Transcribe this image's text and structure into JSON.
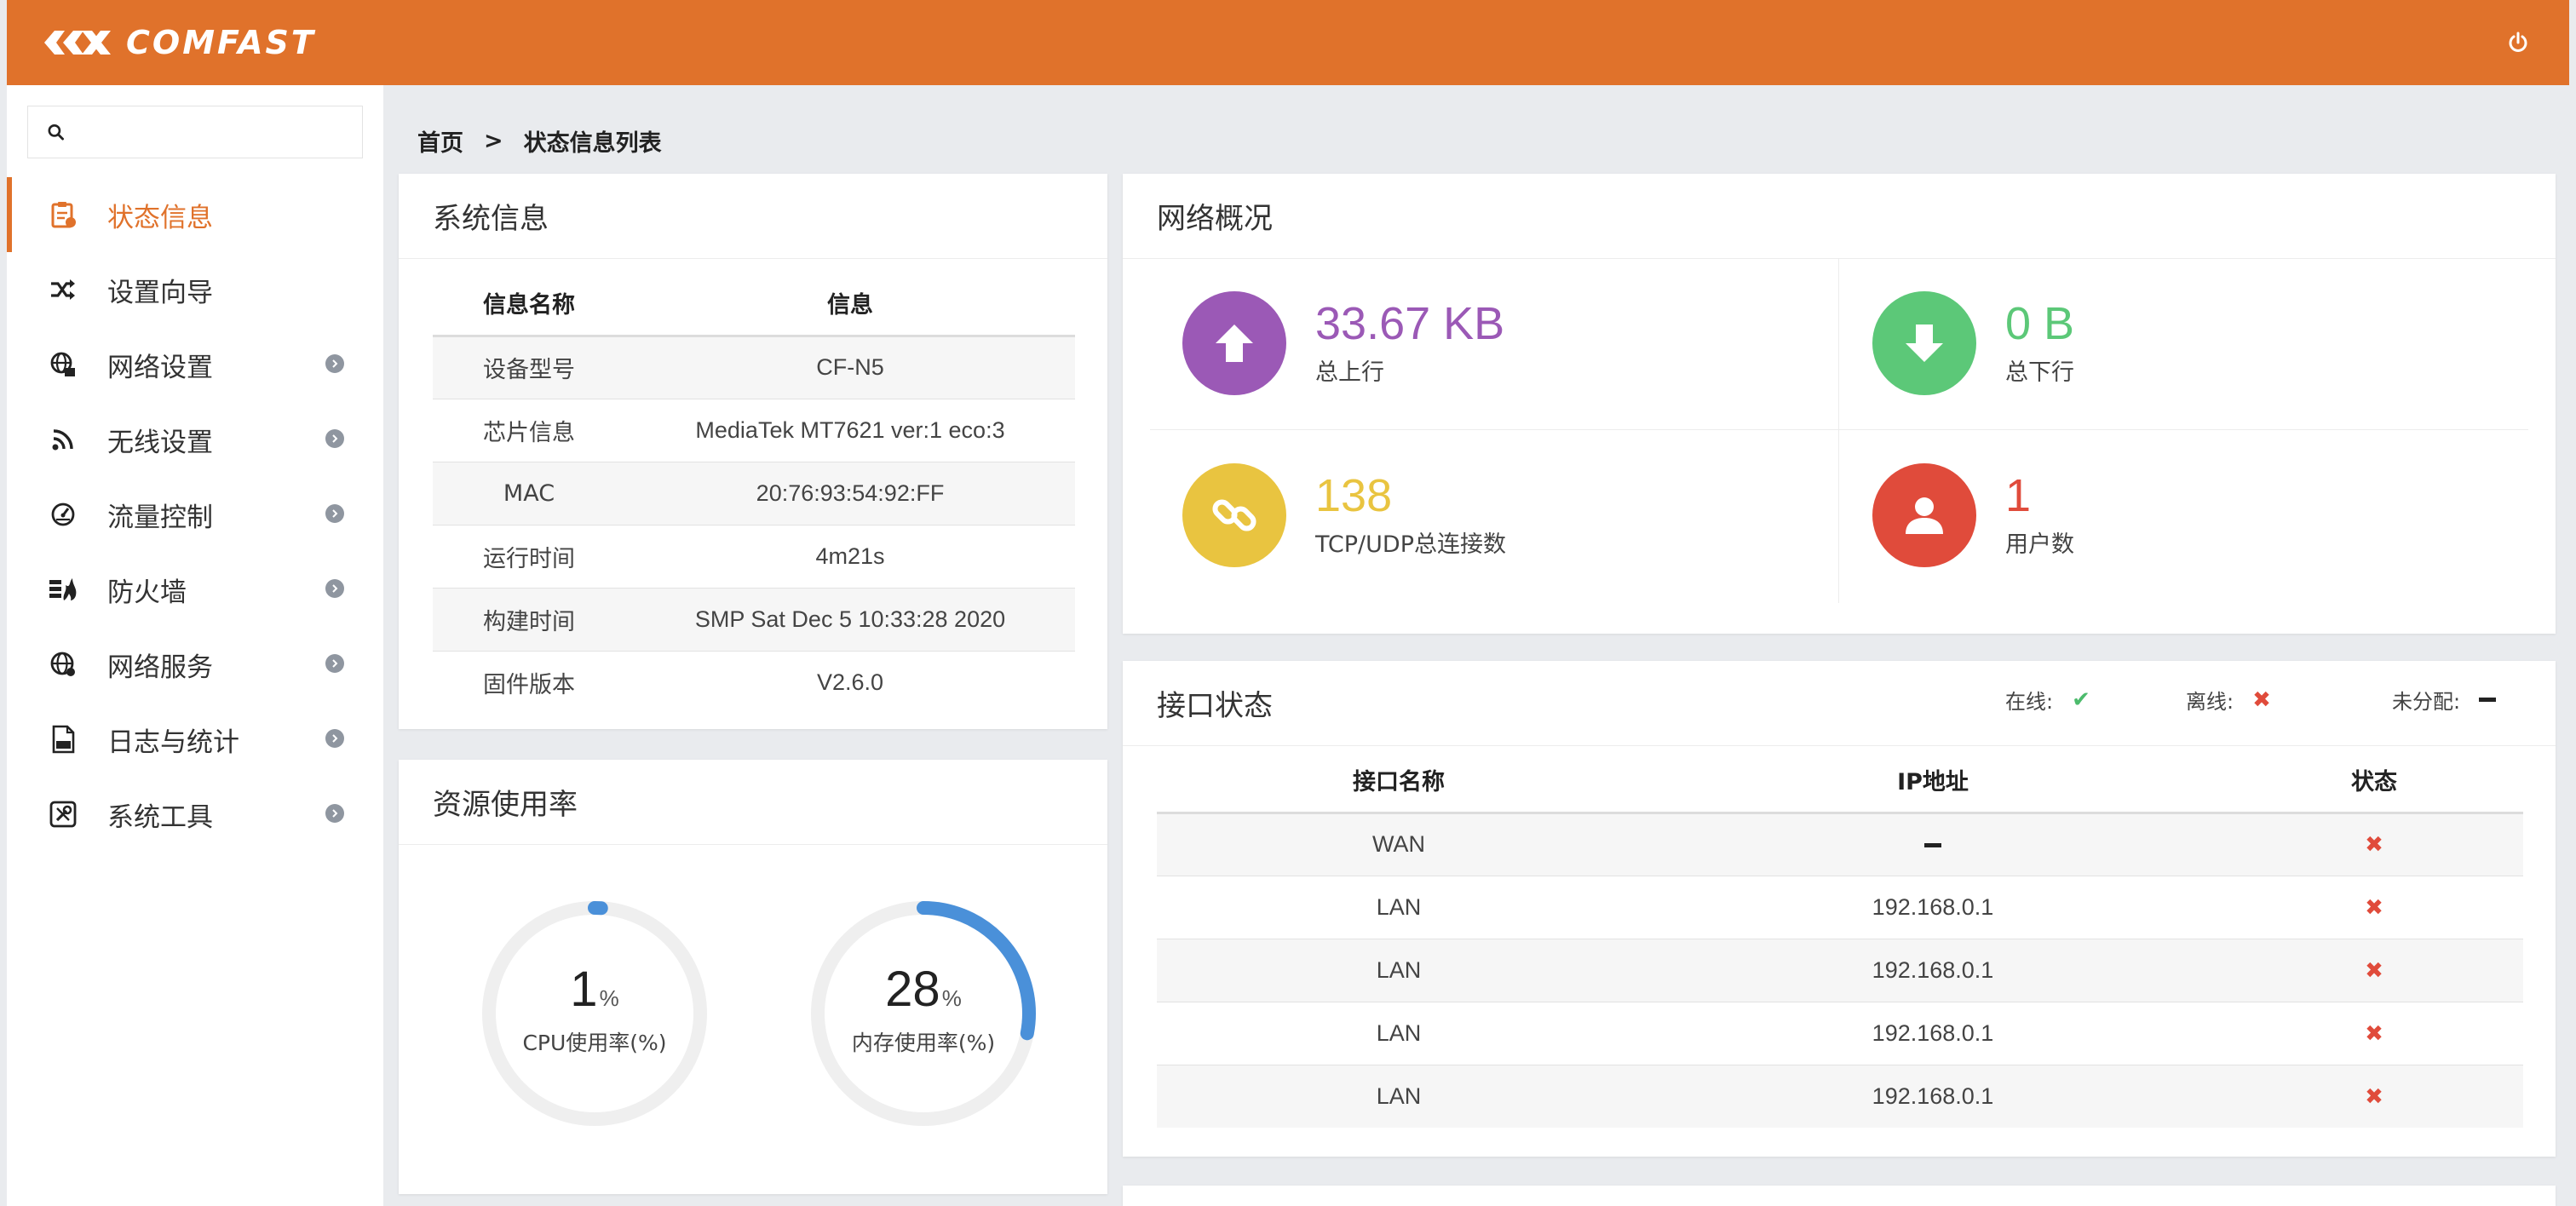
{
  "header": {
    "logo_text": "COMFAST",
    "power_icon": "power-icon"
  },
  "sidebar": {
    "search": {
      "value": "",
      "placeholder": "",
      "icon": "search-icon"
    },
    "items": [
      {
        "label": "状态信息",
        "icon": "clipboard-icon",
        "active": true,
        "has_submenu": false
      },
      {
        "label": "设置向导",
        "icon": "shuffle-icon",
        "active": false,
        "has_submenu": false
      },
      {
        "label": "网络设置",
        "icon": "globe-network-icon",
        "active": false,
        "has_submenu": true
      },
      {
        "label": "无线设置",
        "icon": "wifi-icon",
        "active": false,
        "has_submenu": true
      },
      {
        "label": "流量控制",
        "icon": "gauge-icon",
        "active": false,
        "has_submenu": true
      },
      {
        "label": "防火墙",
        "icon": "firewall-icon",
        "active": false,
        "has_submenu": true
      },
      {
        "label": "网络服务",
        "icon": "globe-icon",
        "active": false,
        "has_submenu": true
      },
      {
        "label": "日志与统计",
        "icon": "log-file-icon",
        "active": false,
        "has_submenu": true
      },
      {
        "label": "系统工具",
        "icon": "tools-icon",
        "active": false,
        "has_submenu": true
      }
    ]
  },
  "breadcrumb": {
    "home": "首页",
    "separator": ">",
    "current": "状态信息列表"
  },
  "system_info": {
    "title": "系统信息",
    "headers": [
      "信息名称",
      "信息"
    ],
    "rows": [
      [
        "设备型号",
        "CF-N5"
      ],
      [
        "芯片信息",
        "MediaTek MT7621 ver:1 eco:3"
      ],
      [
        "MAC",
        "20:76:93:54:92:FF"
      ],
      [
        "运行时间",
        "4m21s"
      ],
      [
        "构建时间",
        "SMP Sat Dec 5 10:33:28 2020"
      ],
      [
        "固件版本",
        "V2.6.0"
      ]
    ]
  },
  "resource": {
    "title": "资源使用率",
    "cpu": {
      "value": "1",
      "unit": "%",
      "label": "CPU使用率(%)",
      "percent": 1
    },
    "mem": {
      "value": "28",
      "unit": "%",
      "label": "内存使用率(%)",
      "percent": 28
    }
  },
  "network_overview": {
    "title": "网络概况",
    "upload": {
      "value": "33.67 KB",
      "label": "总上行",
      "color": "#9b59b6",
      "icon": "arrow-up-icon"
    },
    "download": {
      "value": "0 B",
      "label": "总下行",
      "color": "#5cc878",
      "icon": "arrow-down-icon"
    },
    "connections": {
      "value": "138",
      "label": "TCP/UDP总连接数",
      "color": "#e9c440",
      "icon": "link-icon"
    },
    "users": {
      "value": "1",
      "label": "用户数",
      "color": "#e04b3b",
      "icon": "user-icon"
    }
  },
  "interface_status": {
    "title": "接口状态",
    "legend": {
      "online": "在线:",
      "offline": "离线:",
      "unassigned": "未分配:"
    },
    "headers": [
      "接口名称",
      "IP地址",
      "状态"
    ],
    "rows": [
      {
        "name": "WAN",
        "ip": "",
        "ip_icon": "dash-icon",
        "status": "offline"
      },
      {
        "name": "LAN",
        "ip": "192.168.0.1",
        "status": "offline"
      },
      {
        "name": "LAN",
        "ip": "192.168.0.1",
        "status": "offline"
      },
      {
        "name": "LAN",
        "ip": "192.168.0.1",
        "status": "offline"
      },
      {
        "name": "LAN",
        "ip": "192.168.0.1",
        "status": "offline"
      }
    ]
  },
  "colors": {
    "accent": "#e0722b",
    "gauge": "#4a90d9",
    "gauge_track": "#efefef",
    "offline": "#e04b3b",
    "online": "#4cbb6c"
  }
}
